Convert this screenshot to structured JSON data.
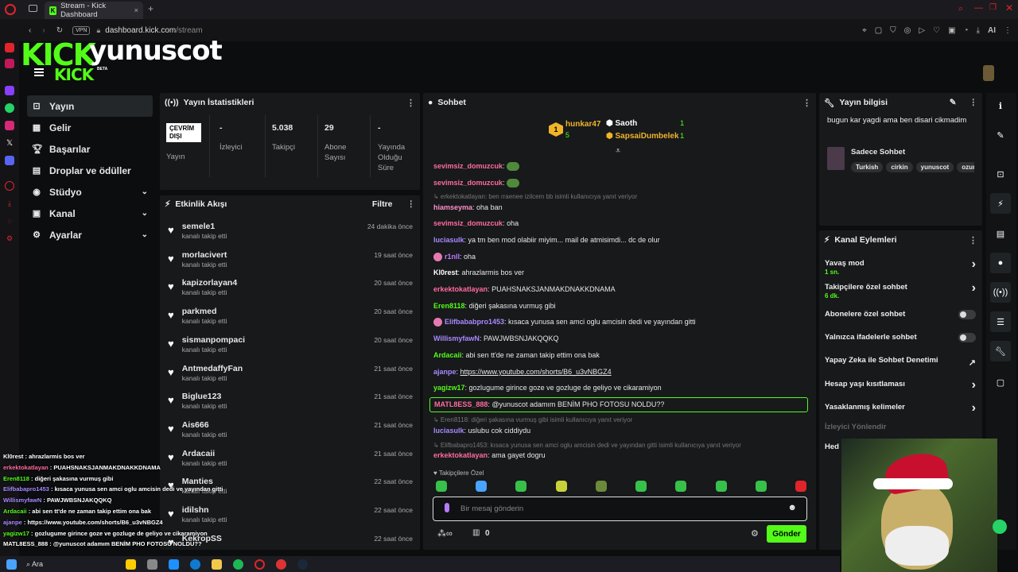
{
  "browser": {
    "tab_title": "Stream - Kick Dashboard",
    "url_host": "dashboard.kick.com",
    "url_path": "/stream",
    "vpn_label": "VPN",
    "ai_label": "AI"
  },
  "brand": {
    "logo": "KICK",
    "username": "yunuscot",
    "sublogo": "KICK",
    "beta": "BETA"
  },
  "nav": [
    {
      "label": "Yayın",
      "icon": "broadcast-icon",
      "active": true
    },
    {
      "label": "Gelir",
      "icon": "revenue-icon"
    },
    {
      "label": "Başarılar",
      "icon": "trophy-icon"
    },
    {
      "label": "Droplar ve ödüller",
      "icon": "gift-icon"
    },
    {
      "label": "Stüdyo",
      "icon": "studio-icon",
      "chevron": true
    },
    {
      "label": "Kanal",
      "icon": "channel-icon",
      "chevron": true
    },
    {
      "label": "Ayarlar",
      "icon": "settings-icon",
      "chevron": true
    }
  ],
  "stats": {
    "title": "Yayın İstatistikleri",
    "status_badge": "ÇEVRİM DIŞI",
    "status_label": "Yayın",
    "items": [
      {
        "value": "-",
        "label": "İzleyici"
      },
      {
        "value": "5.038",
        "label": "Takipçi"
      },
      {
        "value": "29",
        "label": "Abone Sayısı"
      },
      {
        "value": "-",
        "label": "Yayında Olduğu Süre"
      }
    ]
  },
  "activity": {
    "title": "Etkinlik Akışı",
    "filter": "Filtre",
    "events": [
      {
        "name": "semele1",
        "sub": "kanalı takip etti",
        "time": "24 dakika önce"
      },
      {
        "name": "morlacivert",
        "sub": "kanalı takip etti",
        "time": "19 saat önce"
      },
      {
        "name": "kapizorlayan4",
        "sub": "kanalı takip etti",
        "time": "20 saat önce"
      },
      {
        "name": "parkmed",
        "sub": "kanalı takip etti",
        "time": "20 saat önce"
      },
      {
        "name": "sismanpompaci",
        "sub": "kanalı takip etti",
        "time": "20 saat önce"
      },
      {
        "name": "AntmedaffyFan",
        "sub": "kanalı takip etti",
        "time": "21 saat önce"
      },
      {
        "name": "Biglue123",
        "sub": "kanalı takip etti",
        "time": "21 saat önce"
      },
      {
        "name": "Ais666",
        "sub": "kanalı takip etti",
        "time": "21 saat önce"
      },
      {
        "name": "Ardacaii",
        "sub": "kanalı takip etti",
        "time": "21 saat önce"
      },
      {
        "name": "Manties",
        "sub": "kanalı takip etti",
        "time": "22 saat önce"
      },
      {
        "name": "idilshn",
        "sub": "kanalı takip etti",
        "time": "22 saat önce"
      },
      {
        "name": "KekropSS",
        "sub": "",
        "time": "22 saat önce"
      }
    ]
  },
  "chat": {
    "title": "Sohbet",
    "leaders": [
      {
        "rank": "1",
        "name": "hunkar47",
        "count": "5"
      },
      {
        "name": "Saoth",
        "count": "1"
      },
      {
        "name": "SapsaiDumbelek",
        "count": "1"
      }
    ],
    "messages": [
      {
        "user": "sevimsiz_domuzcuk",
        "color": "#ff6b9e",
        "text": "",
        "emote": true
      },
      {
        "user": "sevimsiz_domuzcuk",
        "color": "#ff6b9e",
        "text": "",
        "emote": true
      },
      {
        "reply": "erkektokatlayan: ben rraenee izilcem bb isimli kullanıcıya yanıt veriyor"
      },
      {
        "user": "hiamseyma",
        "color": "#ff8fc8",
        "text": "oha ban"
      },
      {
        "user": "sevimsiz_domuzcuk",
        "color": "#ff6b9e",
        "text": "oha"
      },
      {
        "user": "luciasulk",
        "color": "#a889ff",
        "text": "ya tm ben mod olabiir miyim... mail de atmisimdi... dc de olur"
      },
      {
        "user": "r1nll",
        "color": "#b97bff",
        "text": "oha",
        "badge": true
      },
      {
        "user": "Kl0rest",
        "color": "#ffffff",
        "text": "ahrazlarmis bos ver"
      },
      {
        "user": "erkektokatlayan",
        "color": "#ff6b9e",
        "text": "PUAHSNAKSJANMAKDNAKKDNAMA"
      },
      {
        "user": "Eren8118",
        "color": "#53fc18",
        "text": "diğeri şakasına vurmuş gibi"
      },
      {
        "user": "Elifbababpro1453",
        "color": "#a889ff",
        "text": "kısaca yunusa sen amci oglu amcisin dedi ve yayından gitti",
        "badge": true
      },
      {
        "user": "WillismyfawN",
        "color": "#a889ff",
        "text": "PAWJWBSNJAKQQKQ"
      },
      {
        "user": "Ardacaii",
        "color": "#53fc18",
        "text": "abi sen tt'de ne zaman takip ettim ona bak"
      },
      {
        "user": "ajanpe",
        "color": "#a889ff",
        "text": "https://www.youtube.com/shorts/B6_u3vNBGZ4",
        "link": true
      },
      {
        "user": "yagizw17",
        "color": "#53fc18",
        "text": "gozlugume girince goze ve gozluge de geliyo ve cikaramiyon"
      },
      {
        "user": "MATL8ESS_888",
        "color": "#ff6b9e",
        "text": "@yunuscot adamım BENİM PHO FOTOSU NOLDU??",
        "highlight": true
      },
      {
        "reply": "Eren8118: diğeri şakasına vurmuş gibi isimli kullanıcıya yanıt veriyor"
      },
      {
        "user": "luciasulk",
        "color": "#a889ff",
        "text": "uslubu cok ciddiydu"
      },
      {
        "reply": "Elifbabapro1453: kısaca yunusa sen amci oglu amcisin dedi ve yayından gitti isimli kullanıcıya yanıt veriyor"
      },
      {
        "user": "erkektokatlayan",
        "color": "#ff6b9e",
        "text": "ama gayet dogru"
      }
    ],
    "followers_only": "Takipçilere Özel",
    "input_placeholder": "Bir mesaj gönderin",
    "points": "0",
    "send": "Gönder"
  },
  "stream_info": {
    "title": "Yayın bilgisi",
    "stream_title": "bugun kar yagdi ama ben disari cikmadim",
    "category": "Sadece Sohbet",
    "tags": [
      "Turkish",
      "cirkin",
      "yunuscot",
      "ozur"
    ]
  },
  "channel_actions": {
    "title": "Kanal Eylemleri",
    "items": [
      {
        "label": "Yavaş mod",
        "sub": "1 sn.",
        "type": "chevron"
      },
      {
        "label": "Takipçilere özel sohbet",
        "sub": "6 dk.",
        "type": "chevron"
      },
      {
        "label": "Abonelere özel sohbet",
        "type": "toggle"
      },
      {
        "label": "Yalnızca ifadelerle sohbet",
        "type": "toggle"
      },
      {
        "label": "Yapay Zeka ile Sohbet Denetimi",
        "type": "external"
      },
      {
        "label": "Hesap yaşı kısıtlaması",
        "type": "chevron"
      },
      {
        "label": "Yasaklanmış kelimeler",
        "type": "chevron"
      },
      {
        "label": "İzleyici Yönlendir",
        "type": "none",
        "muted": true
      },
      {
        "label": "Hed",
        "type": "none"
      }
    ]
  },
  "overlay_chat": [
    {
      "user": "Kl0rest",
      "text": "ahrazlarmis bos ver",
      "color": "#ffffff"
    },
    {
      "user": "erkektokatlayan",
      "text": "PUAHSNAKSJANMAKDNAKKDNAMA",
      "color": "#ff6b9e"
    },
    {
      "user": "Eren8118",
      "text": "diğeri şakasına vurmuş gibi",
      "color": "#53fc18"
    },
    {
      "user": "Elifbabapro1453",
      "text": "kısaca yunusa sen amci oglu amcisin dedi ve yayından gitti",
      "color": "#a889ff"
    },
    {
      "user": "WillismyfawN",
      "text": "PAWJWBSNJAKQQKQ",
      "color": "#a889ff"
    },
    {
      "user": "Ardacaii",
      "text": "abi sen tt'de ne zaman takip ettim ona bak",
      "color": "#53fc18"
    },
    {
      "user": "ajanpe",
      "text": "https://www.youtube.com/shorts/B6_u3vNBGZ4",
      "color": "#a889ff"
    },
    {
      "user": "yagizw17",
      "text": "gozlugume girince goze ve gozluge de geliyo ve cikaramiyon",
      "color": "#53fc18"
    },
    {
      "user": "MATL8ESS_888",
      "text": "@yunuscot adamım BENİM PHO FOTOSU NOLDU??",
      "color": "#ffffff"
    }
  ],
  "taskbar": {
    "search": "Ara"
  },
  "colors": {
    "accent": "#53fc18",
    "panel": "#17191b",
    "bg": "#0b0d0e"
  }
}
